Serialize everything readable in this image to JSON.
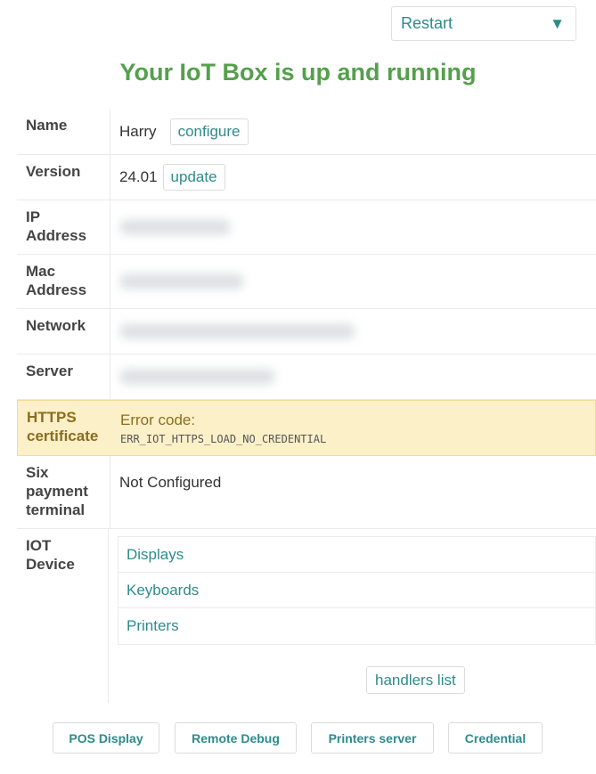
{
  "header": {
    "restart_select": {
      "selected": "Restart",
      "icon": "chevron-down-icon"
    },
    "title": "Your IoT Box is up and running"
  },
  "colors": {
    "accent": "#2e8b8b",
    "title_green": "#54a04c",
    "warning_bg": "#fcf0c9"
  },
  "info": {
    "name": {
      "label": "Name",
      "value": "Harry",
      "button": "configure"
    },
    "version": {
      "label": "Version",
      "value": "24.01",
      "button": "update"
    },
    "ip_address": {
      "label_line1": "IP",
      "label_line2": "Address"
    },
    "mac_address": {
      "label_line1": "Mac",
      "label_line2": "Address"
    },
    "network": {
      "label": "Network"
    },
    "server": {
      "label": "Server"
    },
    "https_certificate": {
      "label_line1": "HTTPS",
      "label_line2": "certificate",
      "error_title": "Error code:",
      "error_code": "ERR_IOT_HTTPS_LOAD_NO_CREDENTIAL"
    },
    "six_payment": {
      "label_line1": "Six",
      "label_line2": "payment",
      "label_line3": "terminal",
      "value": "Not Configured"
    },
    "iot_device": {
      "label_line1": "IOT",
      "label_line2": "Device",
      "devices": [
        "Displays",
        "Keyboards",
        "Printers"
      ],
      "handlers_button": "handlers list"
    }
  },
  "footer": {
    "buttons": [
      "POS Display",
      "Remote Debug",
      "Printers server",
      "Credential"
    ]
  }
}
